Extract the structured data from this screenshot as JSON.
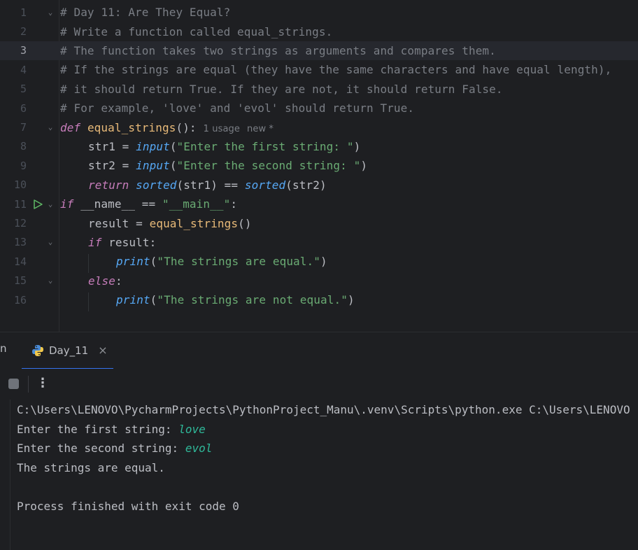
{
  "editor": {
    "current_line": 3,
    "lines": [
      {
        "num": "1",
        "text": "# Day 11: Are They Equal?"
      },
      {
        "num": "2",
        "text": "# Write a function called equal_strings."
      },
      {
        "num": "3",
        "text": "# The function takes two strings as arguments and compares them."
      },
      {
        "num": "4",
        "text": "# If the strings are equal (they have the same characters and have equal length),"
      },
      {
        "num": "5",
        "text": "# it should return True. If they are not, it should return False."
      },
      {
        "num": "6",
        "text": "# For example, 'love' and 'evol' should return True."
      },
      {
        "num": "7",
        "kw": "def",
        "name": "equal_strings",
        "rest": "():",
        "hint_usage": "1 usage",
        "hint_new": "new *"
      },
      {
        "num": "8",
        "var": "str1 = ",
        "fn": "input",
        "open": "(",
        "str": "\"Enter the first string: \"",
        "close": ")"
      },
      {
        "num": "9",
        "var": "str2 = ",
        "fn": "input",
        "open": "(",
        "str": "\"Enter the second string: \"",
        "close": ")"
      },
      {
        "num": "10",
        "kw": "return",
        "fn1": "sorted",
        "mid": "(str1) == ",
        "fn2": "sorted",
        "end": "(str2)"
      },
      {
        "num": "11",
        "kw": "if",
        "mid": " __name__ == ",
        "str": "\"__main__\"",
        "end": ":"
      },
      {
        "num": "12",
        "var": "result = ",
        "call": "equal_strings",
        "end": "()"
      },
      {
        "num": "13",
        "kw": "if",
        "end": " result:"
      },
      {
        "num": "14",
        "fn": "print",
        "open": "(",
        "str": "\"The strings are equal.\"",
        "close": ")"
      },
      {
        "num": "15",
        "kw": "else",
        "end": ":"
      },
      {
        "num": "16",
        "fn": "print",
        "open": "(",
        "str": "\"The strings are not equal.\"",
        "close": ")"
      }
    ]
  },
  "tool_window": {
    "partial_tab": "n",
    "active_tab": "Day_11",
    "close_icon": "×",
    "more_icon": "⋮"
  },
  "console": {
    "line1": "C:\\Users\\LENOVO\\PycharmProjects\\PythonProject_Manu\\.venv\\Scripts\\python.exe C:\\Users\\LENOVO",
    "prompt1": "Enter the first string: ",
    "input1": "love",
    "prompt2": "Enter the second string: ",
    "input2": "evol",
    "result": "The strings are equal.",
    "exit": "Process finished with exit code 0"
  },
  "colors": {
    "background": "#1e1f22",
    "comment": "#7a7e85",
    "keyword": "#c77dbb",
    "string": "#6aab73",
    "function": "#56a8f5",
    "def_name": "#e8ba79",
    "accent": "#3574f0",
    "user_input": "#2fb99a"
  }
}
